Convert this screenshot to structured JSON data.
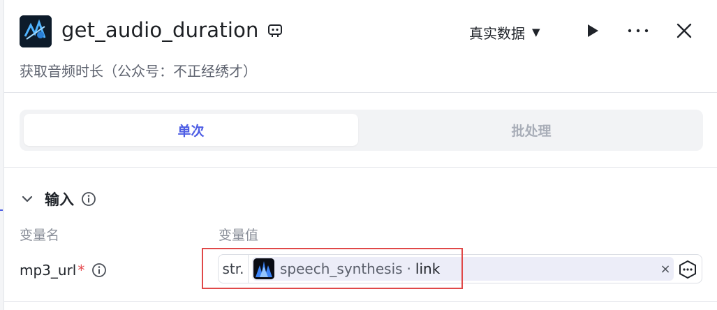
{
  "header": {
    "title": "get_audio_duration",
    "mode_label": "真实数据",
    "description": "获取音频时长（公众号：不正经绣才）"
  },
  "tabs": [
    {
      "label": "单次",
      "active": true
    },
    {
      "label": "批处理",
      "active": false
    }
  ],
  "input_section": {
    "title": "输入",
    "col_name_label": "变量名",
    "col_value_label": "变量值",
    "row": {
      "name": "mp3_url",
      "required_mark": "*",
      "type_tag": "str.",
      "ref_node": "speech_synthesis",
      "ref_separator": "·",
      "ref_field": "link",
      "clear_glyph": "×"
    }
  },
  "colors": {
    "accent": "#4e5ee4",
    "highlight": "#e04848",
    "required": "#e5484d"
  },
  "icons": [
    "app-logo-icon",
    "debug-icon",
    "play-icon",
    "more-icon",
    "close-icon",
    "chevron-down-icon",
    "info-icon",
    "node-ref-icon",
    "variable-picker-icon"
  ]
}
